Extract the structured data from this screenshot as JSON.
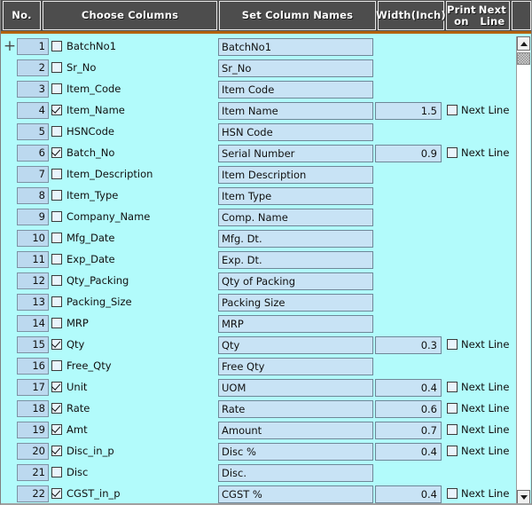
{
  "colors": {
    "grid_background": "#b2fbfb",
    "header_background": "#4d4d4d",
    "header_text": "#ffffff",
    "header_rule": "#b4630f",
    "field_background": "#c8e3f5",
    "number_cell_background": "#bcd9ef"
  },
  "header": {
    "columns": [
      {
        "id": "no",
        "lines": [
          "No."
        ]
      },
      {
        "id": "choose-columns",
        "lines": [
          "Choose Columns"
        ]
      },
      {
        "id": "set-column-names",
        "lines": [
          "Set Column Names"
        ]
      },
      {
        "id": "width",
        "lines": [
          "Width",
          "(Inch)"
        ]
      },
      {
        "id": "print-on-next-line",
        "lines": [
          "Print on",
          "Next Line"
        ]
      },
      {
        "id": "spacer",
        "lines": [
          ""
        ]
      }
    ]
  },
  "next_line_label": "Next Line",
  "expand_icon": "+",
  "rows": [
    {
      "no": "1",
      "checked": false,
      "column": "BatchNo1",
      "name": "BatchNo1",
      "width": "",
      "next_line": null,
      "expandable": true
    },
    {
      "no": "2",
      "checked": false,
      "column": "Sr_No",
      "name": "Sr_No",
      "width": "",
      "next_line": null,
      "expandable": false
    },
    {
      "no": "3",
      "checked": false,
      "column": "Item_Code",
      "name": "Item Code",
      "width": "",
      "next_line": null,
      "expandable": false
    },
    {
      "no": "4",
      "checked": true,
      "column": "Item_Name",
      "name": "Item Name",
      "width": "1.5",
      "next_line": false,
      "expandable": false
    },
    {
      "no": "5",
      "checked": false,
      "column": "HSNCode",
      "name": "HSN Code",
      "width": "",
      "next_line": null,
      "expandable": false
    },
    {
      "no": "6",
      "checked": true,
      "column": "Batch_No",
      "name": "Serial Number",
      "width": "0.9",
      "next_line": false,
      "expandable": false
    },
    {
      "no": "7",
      "checked": false,
      "column": "Item_Description",
      "name": "Item Description",
      "width": "",
      "next_line": null,
      "expandable": false
    },
    {
      "no": "8",
      "checked": false,
      "column": "Item_Type",
      "name": "Item Type",
      "width": "",
      "next_line": null,
      "expandable": false
    },
    {
      "no": "9",
      "checked": false,
      "column": "Company_Name",
      "name": "Comp. Name",
      "width": "",
      "next_line": null,
      "expandable": false
    },
    {
      "no": "10",
      "checked": false,
      "column": "Mfg_Date",
      "name": "Mfg. Dt.",
      "width": "",
      "next_line": null,
      "expandable": false
    },
    {
      "no": "11",
      "checked": false,
      "column": "Exp_Date",
      "name": "Exp. Dt.",
      "width": "",
      "next_line": null,
      "expandable": false
    },
    {
      "no": "12",
      "checked": false,
      "column": "Qty_Packing",
      "name": "Qty of Packing",
      "width": "",
      "next_line": null,
      "expandable": false
    },
    {
      "no": "13",
      "checked": false,
      "column": "Packing_Size",
      "name": "Packing Size",
      "width": "",
      "next_line": null,
      "expandable": false
    },
    {
      "no": "14",
      "checked": false,
      "column": "MRP",
      "name": "MRP",
      "width": "",
      "next_line": null,
      "expandable": false
    },
    {
      "no": "15",
      "checked": true,
      "column": "Qty",
      "name": "Qty",
      "width": "0.3",
      "next_line": false,
      "expandable": false
    },
    {
      "no": "16",
      "checked": false,
      "column": "Free_Qty",
      "name": "Free Qty",
      "width": "",
      "next_line": null,
      "expandable": false
    },
    {
      "no": "17",
      "checked": true,
      "column": "Unit",
      "name": "UOM",
      "width": "0.4",
      "next_line": false,
      "expandable": false
    },
    {
      "no": "18",
      "checked": true,
      "column": "Rate",
      "name": "Rate",
      "width": "0.6",
      "next_line": false,
      "expandable": false
    },
    {
      "no": "19",
      "checked": true,
      "column": "Amt",
      "name": "Amount",
      "width": "0.7",
      "next_line": false,
      "expandable": false
    },
    {
      "no": "20",
      "checked": true,
      "column": "Disc_in_p",
      "name": "Disc %",
      "width": "0.4",
      "next_line": false,
      "expandable": false
    },
    {
      "no": "21",
      "checked": false,
      "column": "Disc",
      "name": "Disc.",
      "width": "",
      "next_line": null,
      "expandable": false
    },
    {
      "no": "22",
      "checked": true,
      "column": "CGST_in_p",
      "name": "CGST %",
      "width": "0.4",
      "next_line": false,
      "expandable": false
    }
  ],
  "scrollbar": {
    "up_icon": "scroll-up-arrow",
    "down_icon": "scroll-down-arrow",
    "thumb_position_percent": 3
  }
}
